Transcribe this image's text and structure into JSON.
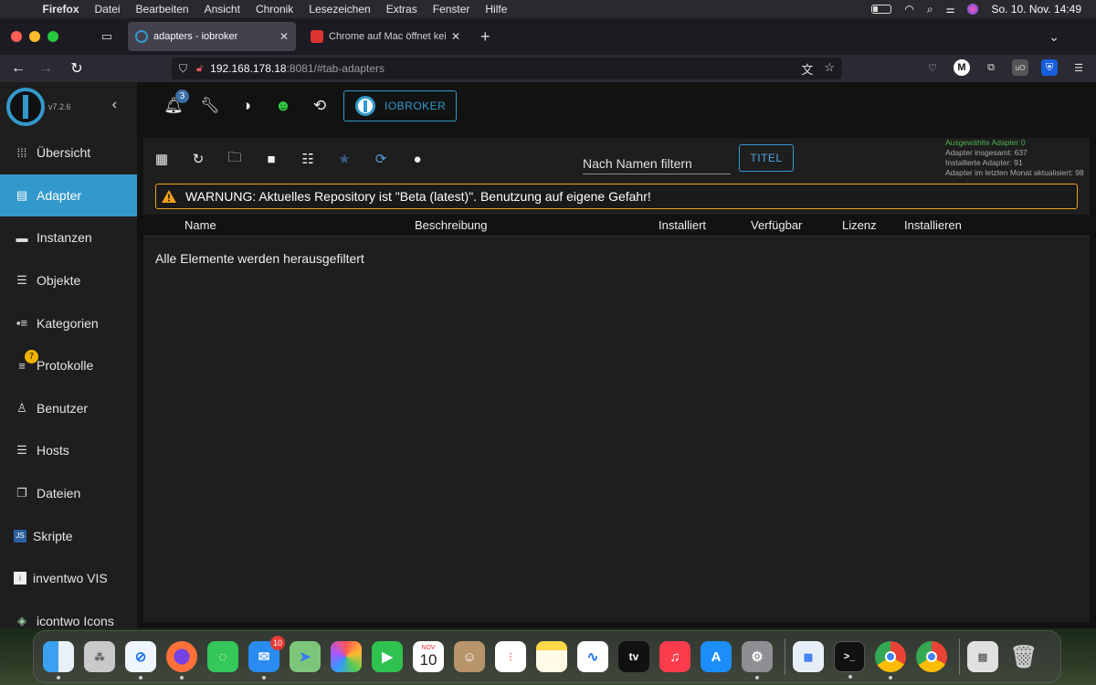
{
  "menubar": {
    "apple": "",
    "items": [
      "Firefox",
      "Datei",
      "Bearbeiten",
      "Ansicht",
      "Chronik",
      "Lesezeichen",
      "Extras",
      "Fenster",
      "Hilfe"
    ],
    "datetime": "So. 10. Nov.  14:49"
  },
  "tabs": [
    {
      "title": "adapters - iobroker",
      "active": true
    },
    {
      "title": "Chrome auf Mac öffnet keine Le",
      "active": false
    }
  ],
  "urlbar": {
    "host": "192.168.178.18",
    "rest": ":8081/#tab-adapters"
  },
  "sidebar": {
    "version": "v7.2.6",
    "items": [
      {
        "label": "Übersicht",
        "icon": "grid-icon"
      },
      {
        "label": "Adapter",
        "icon": "store-icon",
        "active": true
      },
      {
        "label": "Instanzen",
        "icon": "instances-icon"
      },
      {
        "label": "Objekte",
        "icon": "list-icon"
      },
      {
        "label": "Kategorien",
        "icon": "categories-icon"
      },
      {
        "label": "Protokolle",
        "icon": "log-icon",
        "badge": "7"
      },
      {
        "label": "Benutzer",
        "icon": "user-icon"
      },
      {
        "label": "Hosts",
        "icon": "hosts-icon"
      },
      {
        "label": "Dateien",
        "icon": "files-icon"
      },
      {
        "label": "Skripte",
        "icon": "js-icon"
      },
      {
        "label": "inventwo VIS",
        "icon": "inventwo-icon"
      },
      {
        "label": "icontwo Icons",
        "icon": "icontwo-icon"
      }
    ]
  },
  "toolbar": {
    "notification_count": "3",
    "brand_label": "IOBROKER"
  },
  "filter": {
    "placeholder": "Nach Namen filtern",
    "title_button": "TITEL"
  },
  "stats": {
    "selected": "Ausgewählte Adapter 0",
    "total": "Adapter insgesamt: 637",
    "installed": "Installierte Adapter: 91",
    "updated": "Adapter im letzten Monat aktualisiert: 98"
  },
  "warning": "WARNUNG: Aktuelles Repository ist \"Beta (latest)\". Benutzung auf eigene Gefahr!",
  "table": {
    "headers": [
      "Name",
      "Beschreibung",
      "Installiert",
      "Verfügbar",
      "Lizenz",
      "Installieren"
    ],
    "empty_message": "Alle Elemente werden herausgefiltert"
  },
  "dock": {
    "mail_badge": "10",
    "calendar_month": "NOV",
    "calendar_day": "10",
    "tv_label": "tv"
  },
  "colors": {
    "accent": "#3399cc",
    "warning": "#f0a020",
    "badge": "#f0b400"
  }
}
